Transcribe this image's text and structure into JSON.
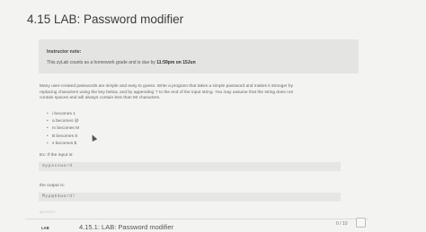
{
  "title": "4.15 LAB: Password modifier",
  "instructor_note": {
    "heading": "Instructor note:",
    "text_prefix": "This zyLab counts as a homework grade and is due by ",
    "due": "11:59pm on 15Jun"
  },
  "description_lines": [
    "Many user-created passwords are simple and easy to guess. Write a program that takes a simple password and makes it stronger by",
    "replacing characters using the key below, and by appending '!' to the end of the input string. You may assume that the string does not",
    "contain spaces and will always contain less than 50 characters."
  ],
  "rules": [
    "i becomes 1",
    "a becomes @",
    "m becomes M",
    "B becomes 8",
    "s becomes $"
  ],
  "example": {
    "input_label": "Ex: If the input is:",
    "input_value": "mypassword",
    "output_label": "the output is:",
    "output_value": "Myp@$$word!"
  },
  "faint_text": "ACTIVITY",
  "bottom": {
    "lab_badge": "LAB",
    "activity_title": "4.15.1: LAB: Password modifier",
    "score": "0 / 10"
  }
}
